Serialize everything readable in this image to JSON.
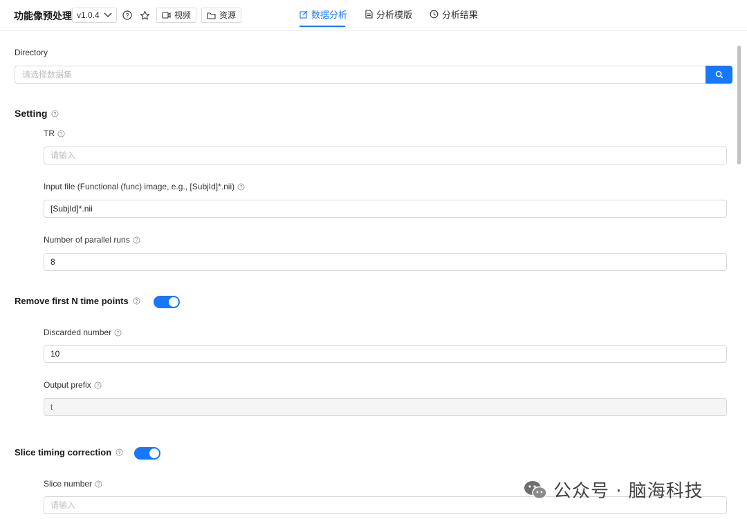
{
  "header": {
    "app_title": "功能像预处理",
    "version": "v1.0.4",
    "video_label": "视频",
    "resources_label": "资源",
    "tabs": [
      {
        "label": "数据分析",
        "icon": "edit-icon",
        "active": true
      },
      {
        "label": "分析模版",
        "icon": "document-icon",
        "active": false
      },
      {
        "label": "分析结果",
        "icon": "history-icon",
        "active": false
      }
    ]
  },
  "directory": {
    "label": "Directory",
    "placeholder": "请选择数据集"
  },
  "setting": {
    "title": "Setting",
    "tr": {
      "label": "TR",
      "placeholder": "请输入",
      "value": ""
    },
    "input_file": {
      "label": "Input file (Functional (func) image, e.g., [SubjId]*.nii)",
      "value": "[SubjId]*.nii"
    },
    "parallel_runs": {
      "label": "Number of parallel runs",
      "value": "8"
    }
  },
  "remove_first": {
    "title": "Remove first N time points",
    "enabled": true,
    "discarded_number": {
      "label": "Discarded number",
      "value": "10"
    },
    "output_prefix": {
      "label": "Output prefix",
      "value": "t"
    }
  },
  "slice_timing": {
    "title": "Slice timing correction",
    "enabled": true,
    "slice_number": {
      "label": "Slice number",
      "placeholder": "请输入",
      "value": ""
    }
  },
  "watermark": "公众号 · 脑海科技",
  "colors": {
    "accent": "#1677ff",
    "border": "#d9d9d9",
    "disabled_bg": "#f5f5f5"
  }
}
